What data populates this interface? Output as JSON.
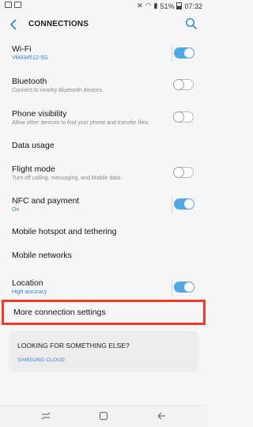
{
  "status": {
    "battery": "51%",
    "time": "07:32"
  },
  "header": {
    "title": "CONNECTIONS"
  },
  "rows": [
    {
      "title": "Wi-Fi",
      "subtitle": "VM434512-5G",
      "toggle": "on"
    },
    {
      "title": "Bluetooth",
      "subtitle": "Connect to nearby Bluetooth devices.",
      "toggle": "off"
    },
    {
      "title": "Phone visibility",
      "subtitle": "Allow other devices to find your phone and transfer files.",
      "toggle": "off"
    },
    {
      "title": "Data usage"
    },
    {
      "title": "Flight mode",
      "subtitle": "Turn off calling, messaging, and Mobile data.",
      "toggle": "off"
    },
    {
      "title": "NFC and payment",
      "subtitle": "On",
      "toggle": "on"
    },
    {
      "title": "Mobile hotspot and tethering"
    },
    {
      "title": "Mobile networks"
    },
    {
      "title": "Location",
      "subtitle": "High accuracy",
      "toggle": "on"
    },
    {
      "title": "More connection settings"
    }
  ],
  "card": {
    "title": "LOOKING FOR SOMETHING ELSE?",
    "link": "SAMSUNG CLOUD"
  },
  "colors": {
    "accent": "#2b7fd6",
    "toggle_on": "#4fa7e6",
    "highlight": "#f23a2a"
  }
}
